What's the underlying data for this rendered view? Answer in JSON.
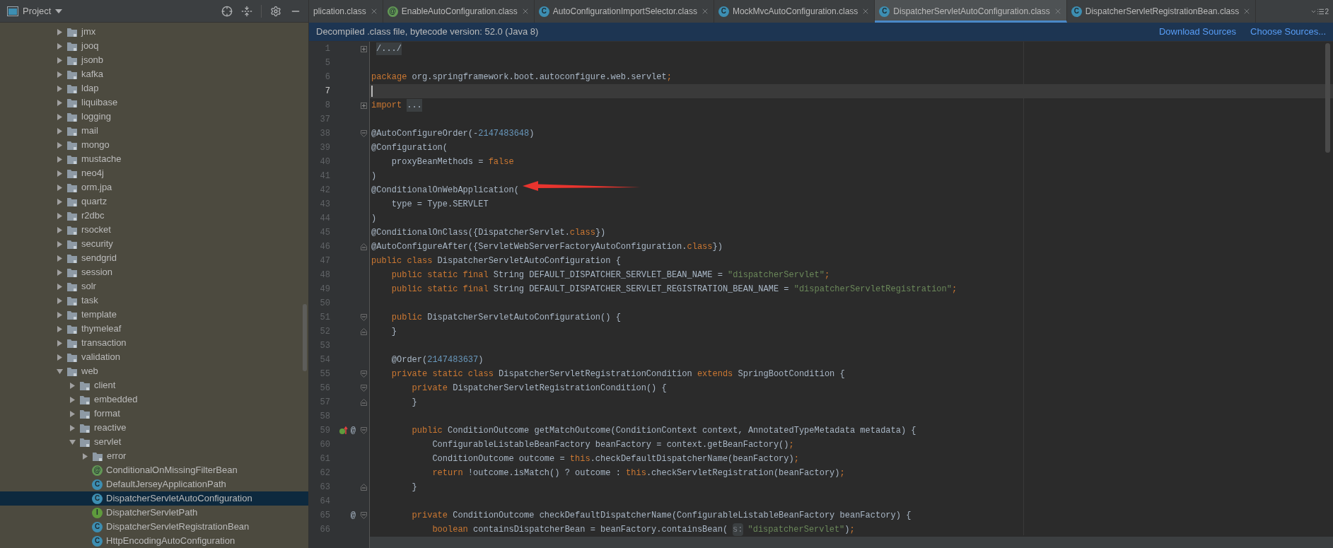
{
  "project_panel": {
    "title": "Project",
    "tree": [
      {
        "label": "jmx",
        "kind": "folder",
        "expanded": false,
        "selected": false
      },
      {
        "label": "jooq",
        "kind": "folder",
        "expanded": false,
        "selected": false
      },
      {
        "label": "jsonb",
        "kind": "folder",
        "expanded": false,
        "selected": false
      },
      {
        "label": "kafka",
        "kind": "folder",
        "expanded": false,
        "selected": false
      },
      {
        "label": "ldap",
        "kind": "folder",
        "expanded": false,
        "selected": false
      },
      {
        "label": "liquibase",
        "kind": "folder",
        "expanded": false,
        "selected": false
      },
      {
        "label": "logging",
        "kind": "folder",
        "expanded": false,
        "selected": false
      },
      {
        "label": "mail",
        "kind": "folder",
        "expanded": false,
        "selected": false
      },
      {
        "label": "mongo",
        "kind": "folder",
        "expanded": false,
        "selected": false
      },
      {
        "label": "mustache",
        "kind": "folder",
        "expanded": false,
        "selected": false
      },
      {
        "label": "neo4j",
        "kind": "folder",
        "expanded": false,
        "selected": false
      },
      {
        "label": "orm.jpa",
        "kind": "folder",
        "expanded": false,
        "selected": false
      },
      {
        "label": "quartz",
        "kind": "folder",
        "expanded": false,
        "selected": false
      },
      {
        "label": "r2dbc",
        "kind": "folder",
        "expanded": false,
        "selected": false
      },
      {
        "label": "rsocket",
        "kind": "folder",
        "expanded": false,
        "selected": false
      },
      {
        "label": "security",
        "kind": "folder",
        "expanded": false,
        "selected": false
      },
      {
        "label": "sendgrid",
        "kind": "folder",
        "expanded": false,
        "selected": false
      },
      {
        "label": "session",
        "kind": "folder",
        "expanded": false,
        "selected": false
      },
      {
        "label": "solr",
        "kind": "folder",
        "expanded": false,
        "selected": false
      },
      {
        "label": "task",
        "kind": "folder",
        "expanded": false,
        "selected": false
      },
      {
        "label": "template",
        "kind": "folder",
        "expanded": false,
        "selected": false
      },
      {
        "label": "thymeleaf",
        "kind": "folder",
        "expanded": false,
        "selected": false
      },
      {
        "label": "transaction",
        "kind": "folder",
        "expanded": false,
        "selected": false
      },
      {
        "label": "validation",
        "kind": "folder",
        "expanded": false,
        "selected": false
      },
      {
        "label": "web",
        "kind": "folder",
        "expanded": true,
        "selected": false,
        "children": [
          {
            "label": "client",
            "kind": "folder",
            "expanded": false,
            "selected": false
          },
          {
            "label": "embedded",
            "kind": "folder",
            "expanded": false,
            "selected": false
          },
          {
            "label": "format",
            "kind": "folder",
            "expanded": false,
            "selected": false
          },
          {
            "label": "reactive",
            "kind": "folder",
            "expanded": false,
            "selected": false
          },
          {
            "label": "servlet",
            "kind": "folder",
            "expanded": true,
            "selected": false,
            "children": [
              {
                "label": "error",
                "kind": "folder",
                "expanded": false,
                "selected": false
              },
              {
                "label": "ConditionalOnMissingFilterBean",
                "kind": "file",
                "badge": "@",
                "color": "#629755",
                "selected": false
              },
              {
                "label": "DefaultJerseyApplicationPath",
                "kind": "file",
                "badge": "C",
                "color": "#3d8eb2",
                "selected": false
              },
              {
                "label": "DispatcherServletAutoConfiguration",
                "kind": "file",
                "badge": "C",
                "color": "#3d8eb2",
                "selected": true
              },
              {
                "label": "DispatcherServletPath",
                "kind": "file",
                "badge": "I",
                "color": "#5f9b3d",
                "selected": false
              },
              {
                "label": "DispatcherServletRegistrationBean",
                "kind": "file",
                "badge": "C",
                "color": "#3d8eb2",
                "selected": false
              },
              {
                "label": "HttpEncodingAutoConfiguration",
                "kind": "file",
                "badge": "C",
                "color": "#3d8eb2",
                "selected": false
              }
            ]
          }
        ]
      }
    ]
  },
  "tabs": [
    {
      "label": "plication.class",
      "selected": false
    },
    {
      "label": "EnableAutoConfiguration.class",
      "badge": "@",
      "color": "#629755",
      "selected": false
    },
    {
      "label": "AutoConfigurationImportSelector.class",
      "badge": "C",
      "color": "#3d8eb2",
      "selected": false
    },
    {
      "label": "MockMvcAutoConfiguration.class",
      "badge": "C",
      "color": "#3d8eb2",
      "selected": false
    },
    {
      "label": "DispatcherServletAutoConfiguration.class",
      "badge": "C",
      "color": "#3d8eb2",
      "selected": true
    },
    {
      "label": "DispatcherServletRegistrationBean.class",
      "badge": "C",
      "color": "#3d8eb2",
      "selected": false
    }
  ],
  "hidden_tabs_count": "2",
  "banner": {
    "message": "Decompiled .class file, bytecode version: 52.0 (Java 8)",
    "links": [
      "Download Sources",
      "Choose Sources..."
    ]
  },
  "editor": {
    "lines": [
      {
        "num": "1",
        "fold": {
          "kind": "plus"
        },
        "current": false,
        "tokens": [
          {
            "kind": "folded",
            "text": "/.../"
          }
        ]
      },
      {
        "num": "5",
        "current": false
      },
      {
        "num": "6",
        "current": false,
        "tokens": [
          {
            "kind": "kw",
            "text": "package"
          },
          {
            "kind": "plain",
            "text": " org.springframework.boot.autoconfigure.web.servlet"
          },
          {
            "kind": "kw",
            "text": ";"
          }
        ]
      },
      {
        "num": "7",
        "current": true
      },
      {
        "num": "8",
        "fold": {
          "kind": "plus"
        },
        "current": false,
        "tokens": [
          {
            "kind": "kw",
            "text": "import"
          },
          {
            "kind": "folded",
            "text": "..."
          }
        ]
      },
      {
        "num": "37",
        "current": false
      },
      {
        "num": "38",
        "fold": {
          "kind": "open"
        },
        "current": false,
        "tokens": [
          {
            "kind": "plain",
            "text": "@AutoConfigureOrder(-"
          },
          {
            "kind": "num",
            "text": "2147483648"
          },
          {
            "kind": "plain",
            "text": ")"
          }
        ]
      },
      {
        "num": "39",
        "current": false,
        "tokens": [
          {
            "kind": "plain",
            "text": "@Configuration("
          }
        ]
      },
      {
        "num": "40",
        "current": false,
        "tokens": [
          {
            "kind": "plain",
            "text": "    proxyBeanMethods = "
          },
          {
            "kind": "kw",
            "text": "false"
          }
        ]
      },
      {
        "num": "41",
        "current": false,
        "tokens": [
          {
            "kind": "plain",
            "text": ")"
          }
        ]
      },
      {
        "num": "42",
        "current": false,
        "tokens": [
          {
            "kind": "plain",
            "text": "@ConditionalOnWebApplication("
          }
        ]
      },
      {
        "num": "43",
        "current": false,
        "tokens": [
          {
            "kind": "plain",
            "text": "    type = Type.SERVLET"
          }
        ]
      },
      {
        "num": "44",
        "current": false,
        "tokens": [
          {
            "kind": "plain",
            "text": ")"
          }
        ]
      },
      {
        "num": "45",
        "current": false,
        "tokens": [
          {
            "kind": "plain",
            "text": "@ConditionalOnClass({DispatcherServlet."
          },
          {
            "kind": "kw",
            "text": "class"
          },
          {
            "kind": "plain",
            "text": "})"
          }
        ]
      },
      {
        "num": "46",
        "fold": {
          "kind": "close"
        },
        "current": false,
        "tokens": [
          {
            "kind": "plain",
            "text": "@AutoConfigureAfter({ServletWebServerFactoryAutoConfiguration."
          },
          {
            "kind": "kw",
            "text": "class"
          },
          {
            "kind": "plain",
            "text": "})"
          }
        ]
      },
      {
        "num": "47",
        "current": false,
        "tokens": [
          {
            "kind": "kw",
            "text": "public class"
          },
          {
            "kind": "plain",
            "text": " DispatcherServletAutoConfiguration {"
          }
        ]
      },
      {
        "num": "48",
        "current": false,
        "tokens": [
          {
            "kind": "kw",
            "text": "    public static final"
          },
          {
            "kind": "plain",
            "text": " String DEFAULT_DISPATCHER_SERVLET_BEAN_NAME = "
          },
          {
            "kind": "str",
            "text": "\"dispatcherServlet\""
          },
          {
            "kind": "kw",
            "text": ";"
          }
        ]
      },
      {
        "num": "49",
        "current": false,
        "tokens": [
          {
            "kind": "kw",
            "text": "    public static final"
          },
          {
            "kind": "plain",
            "text": " String DEFAULT_DISPATCHER_SERVLET_REGISTRATION_BEAN_NAME = "
          },
          {
            "kind": "str",
            "text": "\"dispatcherServletRegistration\""
          },
          {
            "kind": "kw",
            "text": ";"
          }
        ]
      },
      {
        "num": "50",
        "current": false
      },
      {
        "num": "51",
        "fold": {
          "kind": "open"
        },
        "current": false,
        "tokens": [
          {
            "kind": "kw",
            "text": "    public"
          },
          {
            "kind": "plain",
            "text": " DispatcherServletAutoConfiguration() {"
          }
        ]
      },
      {
        "num": "52",
        "fold": {
          "kind": "close"
        },
        "current": false,
        "tokens": [
          {
            "kind": "plain",
            "text": "    }"
          }
        ]
      },
      {
        "num": "53",
        "current": false
      },
      {
        "num": "54",
        "current": false,
        "tokens": [
          {
            "kind": "plain",
            "text": "    @Order("
          },
          {
            "kind": "num",
            "text": "2147483637"
          },
          {
            "kind": "plain",
            "text": ")"
          }
        ]
      },
      {
        "num": "55",
        "fold": {
          "kind": "open"
        },
        "current": false,
        "tokens": [
          {
            "kind": "kw",
            "text": "    private static class"
          },
          {
            "kind": "plain",
            "text": " DispatcherServletRegistrationCondition "
          },
          {
            "kind": "kw",
            "text": "extends"
          },
          {
            "kind": "plain",
            "text": " SpringBootCondition {"
          }
        ]
      },
      {
        "num": "56",
        "fold": {
          "kind": "open"
        },
        "current": false,
        "tokens": [
          {
            "kind": "kw",
            "text": "        private"
          },
          {
            "kind": "plain",
            "text": " DispatcherServletRegistrationCondition() {"
          }
        ]
      },
      {
        "num": "57",
        "fold": {
          "kind": "close"
        },
        "current": false,
        "tokens": [
          {
            "kind": "plain",
            "text": "        }"
          }
        ]
      },
      {
        "num": "58",
        "current": false
      },
      {
        "num": "59",
        "fold": {
          "kind": "open"
        },
        "current": false,
        "marks": [
          {
            "kind": "implements"
          },
          {
            "kind": "symbol",
            "text": "@"
          }
        ],
        "tokens": [
          {
            "kind": "kw",
            "text": "        public"
          },
          {
            "kind": "plain",
            "text": " ConditionOutcome getMatchOutcome(ConditionContext context, AnnotatedTypeMetadata metadata) {"
          }
        ]
      },
      {
        "num": "60",
        "current": false,
        "tokens": [
          {
            "kind": "plain",
            "text": "            ConfigurableListableBeanFactory beanFactory = context.getBeanFactory()"
          },
          {
            "kind": "kw",
            "text": ";"
          }
        ]
      },
      {
        "num": "61",
        "current": false,
        "tokens": [
          {
            "kind": "plain",
            "text": "            ConditionOutcome outcome = "
          },
          {
            "kind": "kw",
            "text": "this"
          },
          {
            "kind": "plain",
            "text": ".checkDefaultDispatcherName(beanFactory)"
          },
          {
            "kind": "kw",
            "text": ";"
          }
        ]
      },
      {
        "num": "62",
        "current": false,
        "tokens": [
          {
            "kind": "kw",
            "text": "            return"
          },
          {
            "kind": "plain",
            "text": " !outcome.isMatch() ? outcome : "
          },
          {
            "kind": "kw",
            "text": "this"
          },
          {
            "kind": "plain",
            "text": ".checkServletRegistration(beanFactory)"
          },
          {
            "kind": "kw",
            "text": ";"
          }
        ]
      },
      {
        "num": "63",
        "fold": {
          "kind": "close"
        },
        "current": false,
        "tokens": [
          {
            "kind": "plain",
            "text": "        }"
          }
        ]
      },
      {
        "num": "64",
        "current": false
      },
      {
        "num": "65",
        "fold": {
          "kind": "open"
        },
        "current": false,
        "marks": [
          {
            "kind": "symbol",
            "text": "@"
          }
        ],
        "tokens": [
          {
            "kind": "kw",
            "text": "        private"
          },
          {
            "kind": "plain",
            "text": " ConditionOutcome checkDefaultDispatcherName(ConfigurableListableBeanFactory beanFactory) {"
          }
        ]
      },
      {
        "num": "66",
        "current": false,
        "tokens": [
          {
            "kind": "kw",
            "text": "            boolean"
          },
          {
            "kind": "plain",
            "text": " containsDispatcherBean = beanFactory.containsBean("
          },
          {
            "kind": "hint",
            "text": "s:"
          },
          {
            "kind": "str",
            "text": "\"dispatcherServlet\""
          },
          {
            "kind": "plain",
            "text": ")"
          },
          {
            "kind": "kw",
            "text": ";"
          }
        ]
      }
    ]
  }
}
